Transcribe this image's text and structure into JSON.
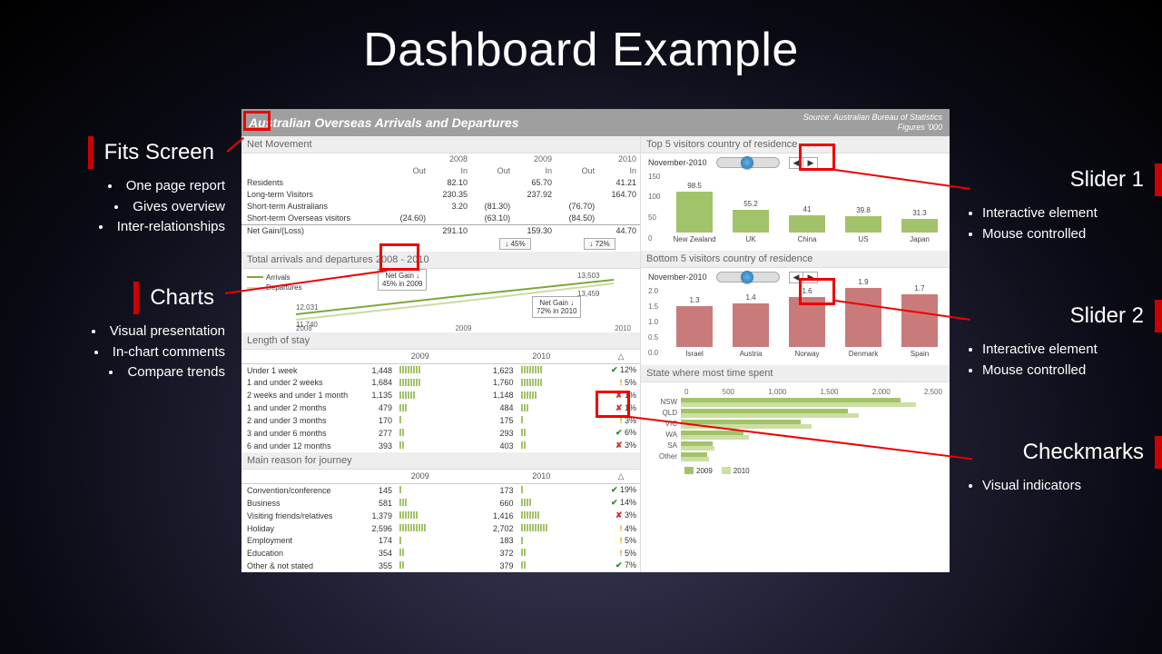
{
  "slide_title": "Dashboard Example",
  "annotations": {
    "fits": {
      "title": "Fits Screen",
      "bullets": [
        "One page report",
        "Gives overview",
        "Inter-relationships"
      ]
    },
    "charts": {
      "title": "Charts",
      "bullets": [
        "Visual presentation",
        "In-chart comments",
        "Compare trends"
      ]
    },
    "slider1": {
      "title": "Slider 1",
      "bullets": [
        "Interactive element",
        "Mouse controlled"
      ]
    },
    "slider2": {
      "title": "Slider 2",
      "bullets": [
        "Interactive element",
        "Mouse controlled"
      ]
    },
    "checks": {
      "title": "Checkmarks",
      "bullets": [
        "Visual indicators"
      ]
    }
  },
  "dash": {
    "title": "Australian Overseas Arrivals and Departures",
    "source_line1": "Source: Australian Bureau of Statistics",
    "source_line2": "Figures '000",
    "net": {
      "heading": "Net Movement",
      "years": [
        "2008",
        "2009",
        "2010"
      ],
      "cols": [
        "Out",
        "In"
      ],
      "rows": [
        {
          "label": "Residents",
          "cells": [
            "",
            "82.10",
            "",
            "65.70",
            "",
            "41.21"
          ]
        },
        {
          "label": "Long-term Visitors",
          "cells": [
            "",
            "230.35",
            "",
            "237.92",
            "",
            "164.70"
          ]
        },
        {
          "label": "Short-term Australians",
          "cells": [
            "",
            "3.20",
            "(81.30)",
            "",
            "(76.70)",
            ""
          ]
        },
        {
          "label": "Short-term Overseas visitors",
          "cells": [
            "(24.60)",
            "",
            "(63.10)",
            "",
            "(84.50)",
            ""
          ]
        }
      ],
      "totals_label": "Net Gain/(Loss)",
      "totals": [
        "",
        "291.10",
        "",
        "159.30",
        "",
        "44.70"
      ],
      "pct_btns": [
        "↓ 45%",
        "↓ 72%"
      ]
    },
    "arr": {
      "heading": "Total arrivals and departures 2008 - 2010",
      "leg_a": "Arrivals",
      "leg_d": "Departures",
      "tip1_l1": "Net Gain ↓",
      "tip1_l2": "45% in 2009",
      "tip2_l1": "Net Gain ↓",
      "tip2_l2": "72% in 2010",
      "val_start_a": "12,031",
      "val_start_d": "11,740",
      "val_end_a": "13,503",
      "val_end_d": "13,459",
      "years": [
        "2008",
        "2009",
        "2010"
      ]
    },
    "stay": {
      "heading": "Length of stay",
      "col_headers": [
        "2009",
        "2010",
        "△"
      ],
      "rows": [
        {
          "label": "Under 1 week",
          "v09": "1,448",
          "bars09": 8,
          "v10": "1,623",
          "bars10": 8,
          "mark": "chk",
          "pct": "12%"
        },
        {
          "label": "1 and under 2 weeks",
          "v09": "1,684",
          "bars09": 8,
          "v10": "1,760",
          "bars10": 8,
          "mark": "warn",
          "pct": "5%"
        },
        {
          "label": "2 weeks and under 1 month",
          "v09": "1,135",
          "bars09": 6,
          "v10": "1,148",
          "bars10": 6,
          "mark": "x",
          "pct": "1%"
        },
        {
          "label": "1 and under 2 months",
          "v09": "479",
          "bars09": 3,
          "v10": "484",
          "bars10": 3,
          "mark": "x",
          "pct": "1%"
        },
        {
          "label": "2 and under 3 months",
          "v09": "170",
          "bars09": 1,
          "v10": "175",
          "bars10": 1,
          "mark": "warn",
          "pct": "3%"
        },
        {
          "label": "3 and under 6 months",
          "v09": "277",
          "bars09": 2,
          "v10": "293",
          "bars10": 2,
          "mark": "chk",
          "pct": "6%"
        },
        {
          "label": "6 and under 12 months",
          "v09": "393",
          "bars09": 2,
          "v10": "403",
          "bars10": 2,
          "mark": "x",
          "pct": "3%"
        }
      ]
    },
    "reason": {
      "heading": "Main reason for journey",
      "col_headers": [
        "2009",
        "2010",
        "△"
      ],
      "rows": [
        {
          "label": "Convention/conference",
          "v09": "145",
          "bars09": 1,
          "v10": "173",
          "bars10": 1,
          "mark": "chk",
          "pct": "19%"
        },
        {
          "label": "Business",
          "v09": "581",
          "bars09": 3,
          "v10": "660",
          "bars10": 4,
          "mark": "chk",
          "pct": "14%"
        },
        {
          "label": "Visiting friends/relatives",
          "v09": "1,379",
          "bars09": 7,
          "v10": "1,416",
          "bars10": 7,
          "mark": "x",
          "pct": "3%"
        },
        {
          "label": "Holiday",
          "v09": "2,596",
          "bars09": 10,
          "v10": "2,702",
          "bars10": 10,
          "mark": "warn",
          "pct": "4%"
        },
        {
          "label": "Employment",
          "v09": "174",
          "bars09": 1,
          "v10": "183",
          "bars10": 1,
          "mark": "warn",
          "pct": "5%"
        },
        {
          "label": "Education",
          "v09": "354",
          "bars09": 2,
          "v10": "372",
          "bars10": 2,
          "mark": "warn",
          "pct": "5%"
        },
        {
          "label": "Other & not stated",
          "v09": "355",
          "bars09": 2,
          "v10": "379",
          "bars10": 2,
          "mark": "chk",
          "pct": "7%"
        }
      ]
    },
    "top5": {
      "heading": "Top 5 visitors country of residence",
      "date": "November-2010",
      "ymax": 150,
      "yticks": [
        "150",
        "100",
        "50",
        "0"
      ],
      "color": "#a3c36a",
      "items": [
        {
          "name": "New Zealand",
          "val": 98.5
        },
        {
          "name": "UK",
          "val": 55.2
        },
        {
          "name": "China",
          "val": 41
        },
        {
          "name": "US",
          "val": 39.8
        },
        {
          "name": "Japan",
          "val": 31.3
        }
      ]
    },
    "bot5": {
      "heading": "Bottom 5 visitors country of residence",
      "date": "November-2010",
      "ymax": 2.0,
      "yticks": [
        "2.0",
        "1.5",
        "1.0",
        "0.5",
        "0.0"
      ],
      "color": "#c97b7b",
      "items": [
        {
          "name": "Israel",
          "val": 1.3
        },
        {
          "name": "Austria",
          "val": 1.4
        },
        {
          "name": "Norway",
          "val": 1.6
        },
        {
          "name": "Denmark",
          "val": 1.9
        },
        {
          "name": "Spain",
          "val": 1.7
        }
      ]
    },
    "state": {
      "heading": "State where most time spent",
      "xticks": [
        "0",
        "500",
        "1,000",
        "1,500",
        "2,000",
        "2,500"
      ],
      "xmax": 2500,
      "leg": [
        "2009",
        "2010"
      ],
      "rows": [
        {
          "name": "NSW",
          "v09": 2100,
          "v10": 2250
        },
        {
          "name": "QLD",
          "v09": 1600,
          "v10": 1700
        },
        {
          "name": "VIC",
          "v09": 1150,
          "v10": 1250
        },
        {
          "name": "WA",
          "v09": 600,
          "v10": 650
        },
        {
          "name": "SA",
          "v09": 300,
          "v10": 320
        },
        {
          "name": "Other",
          "v09": 250,
          "v10": 270
        }
      ]
    }
  },
  "chart_data": [
    {
      "type": "line",
      "title": "Total arrivals and departures 2008 - 2010",
      "x": [
        "2008",
        "2009",
        "2010"
      ],
      "series": [
        {
          "name": "Arrivals",
          "values": [
            12031,
            12800,
            13503
          ]
        },
        {
          "name": "Departures",
          "values": [
            11740,
            12640,
            13459
          ]
        }
      ],
      "annotations": [
        "Net Gain ↓ 45% in 2009",
        "Net Gain ↓ 72% in 2010"
      ]
    },
    {
      "type": "bar",
      "title": "Top 5 visitors country of residence (November-2010)",
      "categories": [
        "New Zealand",
        "UK",
        "China",
        "US",
        "Japan"
      ],
      "values": [
        98.5,
        55.2,
        41,
        39.8,
        31.3
      ],
      "ylim": [
        0,
        150
      ]
    },
    {
      "type": "bar",
      "title": "Bottom 5 visitors country of residence (November-2010)",
      "categories": [
        "Israel",
        "Austria",
        "Norway",
        "Denmark",
        "Spain"
      ],
      "values": [
        1.3,
        1.4,
        1.6,
        1.9,
        1.7
      ],
      "ylim": [
        0,
        2.0
      ]
    },
    {
      "type": "bar",
      "title": "State where most time spent",
      "categories": [
        "NSW",
        "QLD",
        "VIC",
        "WA",
        "SA",
        "Other"
      ],
      "series": [
        {
          "name": "2009",
          "values": [
            2100,
            1600,
            1150,
            600,
            300,
            250
          ]
        },
        {
          "name": "2010",
          "values": [
            2250,
            1700,
            1250,
            650,
            320,
            270
          ]
        }
      ],
      "xlim": [
        0,
        2500
      ]
    }
  ]
}
